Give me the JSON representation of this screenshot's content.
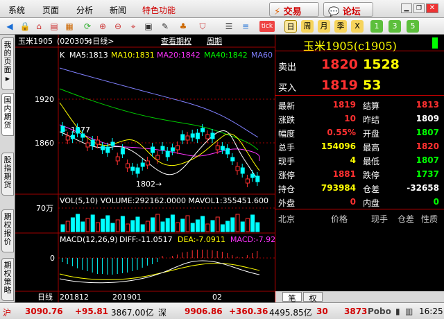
{
  "menu": [
    "系统",
    "页面",
    "分析",
    "新闻",
    "特色功能"
  ],
  "buttons": {
    "trade": "交易",
    "forum": "论坛"
  },
  "toolbar": {
    "period_buttons": [
      "日",
      "周",
      "月",
      "季",
      "X",
      "1",
      "3",
      "5"
    ],
    "period_selected": "日"
  },
  "sidebar": {
    "tabs": [
      "我的页面",
      "国内期货",
      "股指期货",
      "期权报价",
      "期权策略"
    ]
  },
  "chart_header": {
    "title": "玉米1905",
    "code": "(020305)",
    "view": "<日线>",
    "link1": "查看期权",
    "link2": "周期"
  },
  "ma_line": {
    "k": "K",
    "ma5": "MA5:1813",
    "ma10": "MA10:1831",
    "ma20": "MA20:1842",
    "ma40": "MA40:1842",
    "ma60": "MA60"
  },
  "price_axis": {
    "p1920": "1920",
    "p1860": "1860",
    "high_label": "1877",
    "low_label": "1802"
  },
  "volume": {
    "label": "VOL(5,10) VOLUME:292162.0000 MAVOL1:355451.600",
    "axis": "70万"
  },
  "macd": {
    "label": "MACD(12,26,9)",
    "diff": "DIFF:-11.0517",
    "dea": "DEA:-7.0911",
    "macd": "MACD:-7.92",
    "zero": "0"
  },
  "x_axis": {
    "period": "日线",
    "d1": "201812",
    "d2": "201901",
    "d3": "02"
  },
  "quote": {
    "title": "玉米1905(c1905)",
    "sell_label": "卖出",
    "sell_price": "1820",
    "sell_vol": "1528",
    "buy_label": "买入",
    "buy_price": "1819",
    "buy_vol": "53",
    "rows": [
      {
        "l1": "最新",
        "v1": "1819",
        "c1": "#ff3030",
        "l2": "结算",
        "v2": "1813",
        "c2": "#ff3030"
      },
      {
        "l1": "涨跌",
        "v1": "10",
        "c1": "#ff3030",
        "l2": "昨结",
        "v2": "1809",
        "c2": "#ffffff"
      },
      {
        "l1": "幅度",
        "v1": "0.55%",
        "c1": "#ff3030",
        "l2": "开盘",
        "v2": "1807",
        "c2": "#00ff00"
      },
      {
        "l1": "总手",
        "v1": "154096",
        "c1": "#ffff00",
        "l2": "最高",
        "v2": "1820",
        "c2": "#ff3030"
      },
      {
        "l1": "现手",
        "v1": "4",
        "c1": "#ffff00",
        "l2": "最低",
        "v2": "1807",
        "c2": "#00ff00"
      },
      {
        "l1": "涨停",
        "v1": "1881",
        "c1": "#ff3030",
        "l2": "跌停",
        "v2": "1737",
        "c2": "#00ff00"
      },
      {
        "l1": "持仓",
        "v1": "793984",
        "c1": "#ffff00",
        "l2": "仓差",
        "v2": "-32658",
        "c2": "#ffffff"
      },
      {
        "l1": "外盘",
        "v1": "0",
        "c1": "#ff3030",
        "l2": "内盘",
        "v2": "0",
        "c2": "#00ff00"
      }
    ],
    "trade_headers": [
      "北京",
      "价格",
      "现手",
      "仓差",
      "性质"
    ],
    "bottom_tabs": [
      "笔",
      "权"
    ]
  },
  "status": {
    "sh_label": "沪",
    "sh_value": "3090.76",
    "sh_change": "+95.81",
    "sh_amount": "3867.00亿",
    "sz_label": "深",
    "sz_value": "9906.86",
    "sz_change": "+360.36",
    "sz_amount": "4495.85亿",
    "extra": "30",
    "extra2": "3873",
    "brand": "Pobo",
    "time": "16:25"
  },
  "colors": {
    "up": "#ff3030",
    "down": "#00ff00",
    "yellow": "#ffff00",
    "cyan": "#00ffff",
    "grid": "#8b0000"
  }
}
